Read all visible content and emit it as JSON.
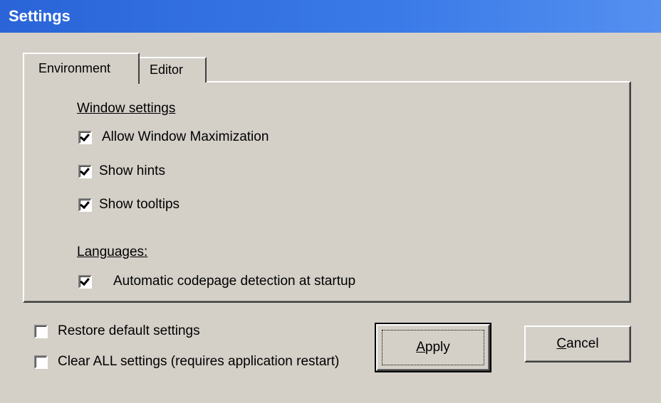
{
  "window": {
    "title": "Settings"
  },
  "tabs": [
    {
      "label": "Environment",
      "active": true
    },
    {
      "label": "Editor",
      "active": false
    }
  ],
  "environment": {
    "window_settings_label": "Window settings",
    "window_settings": [
      {
        "label": "Allow Window Maximization",
        "checked": true
      },
      {
        "label": "Show hints",
        "checked": true
      },
      {
        "label": "Show tooltips",
        "checked": true
      }
    ],
    "languages_label": "Languages:",
    "languages": [
      {
        "label": "Automatic codepage detection at startup",
        "checked": true
      }
    ]
  },
  "options": [
    {
      "label": "Restore default settings",
      "checked": false
    },
    {
      "label": "Clear ALL settings (requires application restart)",
      "checked": false
    }
  ],
  "buttons": {
    "apply": "Apply",
    "cancel": "Cancel"
  },
  "colors": {
    "titlebar": "#2f6ee0",
    "dialog_bg": "#d4d0c8"
  }
}
